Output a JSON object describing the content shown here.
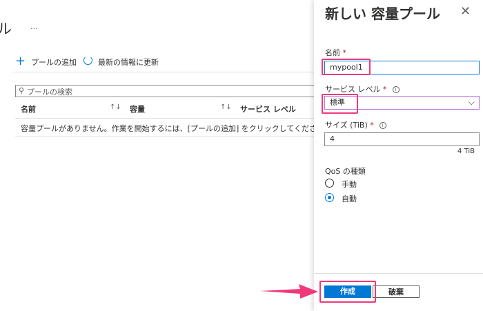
{
  "page": {
    "title_fragment": "ル",
    "more": "…"
  },
  "toolbar": {
    "add_label": "プールの追加",
    "refresh_label": "最新の情報に更新"
  },
  "search": {
    "placeholder": "プールの検索"
  },
  "table": {
    "columns": [
      "名前",
      "容量",
      "サービス レベル"
    ],
    "sort_icon": "↑↓",
    "empty_message": "容量プールがありません。作業を開始するには、[プールの追加] をクリックしてください"
  },
  "panel": {
    "title": "新しい 容量プール",
    "close": "✕",
    "name_label": "名前",
    "name_value": "mypool1",
    "service_level_label": "サービス レベル",
    "service_level_value": "標準",
    "size_label": "サイズ (TiB)",
    "size_value": "4",
    "size_hint": "4 TiB",
    "qos_label": "QoS の種類",
    "qos_options": [
      {
        "label": "手動",
        "selected": false
      },
      {
        "label": "自動",
        "selected": true
      }
    ],
    "required_mark": "*",
    "info": "i",
    "create_label": "作成",
    "discard_label": "破棄"
  },
  "colors": {
    "accent": "#0078d4",
    "highlight": "#f0387a",
    "select_border": "#b86fd6"
  }
}
